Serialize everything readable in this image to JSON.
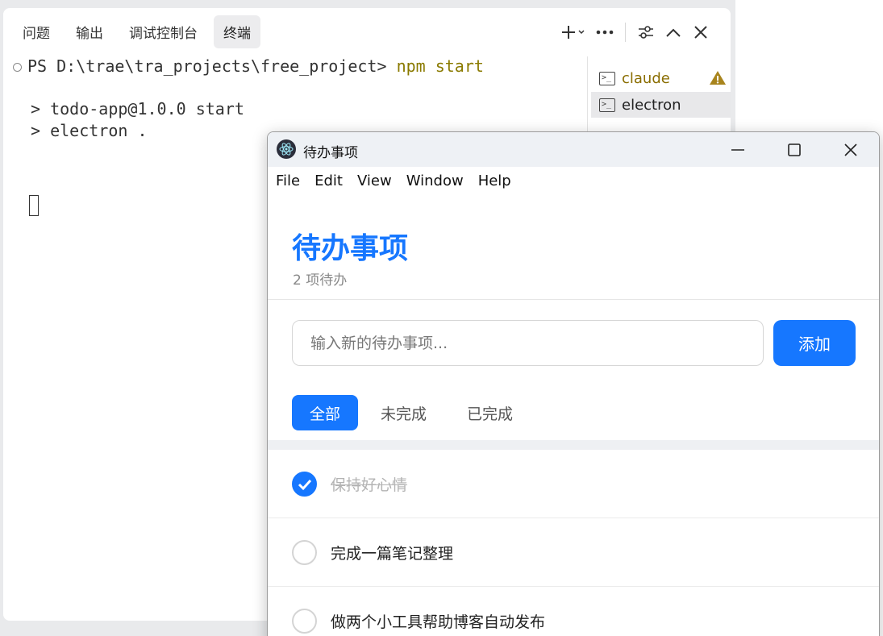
{
  "ide": {
    "tabs": [
      "问题",
      "输出",
      "调试控制台",
      "终端"
    ],
    "active_tab_index": 3,
    "terminal": {
      "prompt": "PS D:\\trae\\tra_projects\\free_project> ",
      "command": "npm start",
      "output": [
        "> todo-app@1.0.0 start",
        "> electron ."
      ]
    },
    "terminal_list": [
      {
        "label": "claude",
        "warning": true
      },
      {
        "label": "electron",
        "active": true
      }
    ]
  },
  "app": {
    "window_title": "待办事项",
    "menu": [
      "File",
      "Edit",
      "View",
      "Window",
      "Help"
    ],
    "title": "待办事项",
    "pending_count": "2 项待办",
    "input_placeholder": "输入新的待办事项...",
    "add_label": "添加",
    "filters": [
      "全部",
      "未完成",
      "已完成"
    ],
    "active_filter_index": 0,
    "todos": [
      {
        "text": "保持好心情",
        "done": true
      },
      {
        "text": "完成一篇笔记整理",
        "done": false
      },
      {
        "text": "做两个小工具帮助博客自动发布",
        "done": false
      }
    ],
    "accent_color": "#1677ff"
  }
}
